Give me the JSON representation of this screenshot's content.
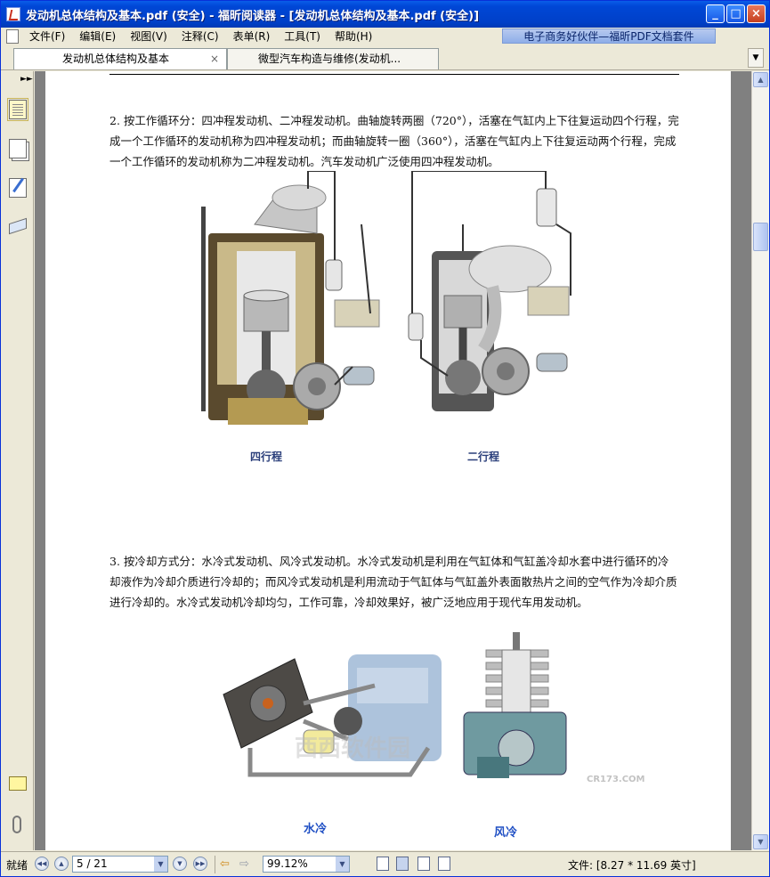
{
  "window": {
    "title": "发动机总体结构及基本.pdf (安全) - 福昕阅读器 - [发动机总体结构及基本.pdf (安全)]",
    "buttons": {
      "minimize": "_",
      "maximize": "□",
      "close": "×"
    }
  },
  "menubar": {
    "items": [
      "文件(F)",
      "编辑(E)",
      "视图(V)",
      "注释(C)",
      "表单(R)",
      "工具(T)",
      "帮助(H)"
    ],
    "banner": "电子商务好伙伴—福昕PDF文档套件"
  },
  "tabs": [
    {
      "label": "发动机总体结构及基本",
      "active": true,
      "close": "×"
    },
    {
      "label": "微型汽车构造与维修(发动机...",
      "active": false
    }
  ],
  "tab_scroll_icon": "chevron-down",
  "sidebar": {
    "icons": [
      "pages-icon",
      "bookmarks-icon",
      "signature-icon",
      "layers-icon",
      "comments-icon",
      "attachments-icon"
    ]
  },
  "document": {
    "paragraph_2": "2. 按工作循环分：四冲程发动机、二冲程发动机。曲轴旋转两圈（720°），活塞在气缸内上下往复运动四个行程，完成一个工作循环的发动机称为四冲程发动机；而曲轴旋转一圈（360°），活塞在气缸内上下往复运动两个行程，完成一个工作循环的发动机称为二冲程发动机。汽车发动机广泛使用四冲程发动机。",
    "caption_four_stroke": "四行程",
    "caption_two_stroke": "二行程",
    "paragraph_3": "3. 按冷却方式分：水冷式发动机、风冷式发动机。水冷式发动机是利用在气缸体和气缸盖冷却水套中进行循环的冷却液作为冷却介质进行冷却的；而风冷式发动机是利用流动于气缸体与气缸盖外表面散热片之间的空气作为冷却介质进行冷却的。水冷式发动机冷却均匀，工作可靠，冷却效果好，被广泛地应用于现代车用发动机。",
    "caption_water_cooled": "水冷",
    "caption_air_cooled": "风冷",
    "watermark": "西西软件园",
    "watermark_sub": "CR173.COM"
  },
  "statusbar": {
    "ready": "就绪",
    "page": "5 / 21",
    "zoom": "99.12%",
    "file_size": "文件: [8.27 * 11.69 英寸]"
  },
  "colors": {
    "titlebar": "#0047d6",
    "workspace": "#808080",
    "caption_blue": "#1f4fc4"
  }
}
